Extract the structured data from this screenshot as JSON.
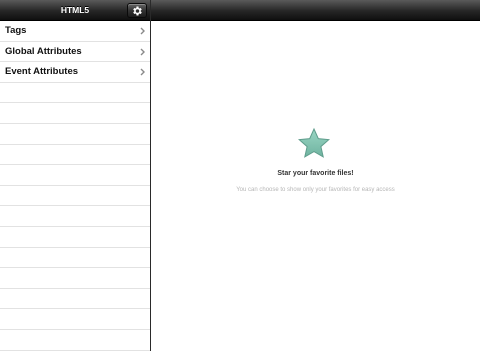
{
  "sidebar": {
    "title": "HTML5",
    "settings_icon": "gear-icon",
    "items": [
      {
        "label": "Tags",
        "icon": "chevron-right-icon"
      },
      {
        "label": "Global Attributes",
        "icon": "chevron-right-icon"
      },
      {
        "label": "Event Attributes",
        "icon": "chevron-right-icon"
      }
    ],
    "empty_rows": 13
  },
  "detail": {
    "star_icon": "star-icon",
    "star_color": "#7fc4b0",
    "empty_title": "Star your favorite files!",
    "empty_subtitle": "You can choose to show only your favorites for easy access"
  }
}
